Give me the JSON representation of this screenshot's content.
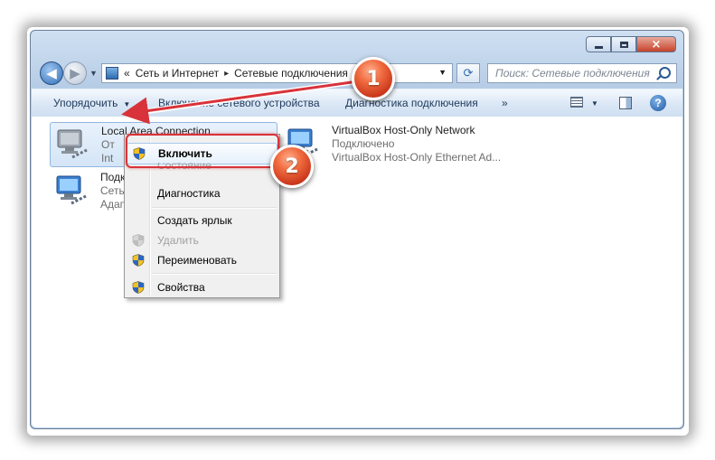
{
  "window": {
    "buttons": {
      "minimize": "minimize",
      "maximize": "maximize",
      "close": "×"
    }
  },
  "nav": {
    "back_glyph": "◀",
    "forward_glyph": "▶",
    "history_glyph": "▼",
    "breadcrumb_root_glyph": "«",
    "breadcrumbs": [
      "Сеть и Интернет",
      "Сетевые подключения"
    ],
    "separator_glyph": "▸",
    "address_drop_glyph": "▼",
    "refresh_glyph": "⟳"
  },
  "search": {
    "placeholder": "Поиск: Сетевые подключения"
  },
  "toolbar": {
    "organize": "Упорядочить",
    "enable_device": "Включение сетевого устройства",
    "diagnose": "Диагностика подключения",
    "more": "»",
    "dropdown_glyph": "▼",
    "help_glyph": "?"
  },
  "connections": [
    {
      "name": "Local Area Connection",
      "status": "От",
      "adapter": "Int"
    },
    {
      "name": "Подк",
      "status": "Сеть",
      "adapter": "Адап"
    },
    {
      "name": "VirtualBox Host-Only Network",
      "status": "Подключено",
      "adapter": "VirtualBox Host-Only Ethernet Ad..."
    }
  ],
  "context_menu": {
    "items": [
      {
        "label": "Включить",
        "shield": true,
        "bold": true,
        "disabled": false
      },
      {
        "label": "Состояние",
        "shield": false,
        "bold": false,
        "disabled": true
      },
      {
        "label": "Диагностика",
        "shield": false,
        "bold": false,
        "disabled": false
      },
      {
        "label": "Создать ярлык",
        "shield": false,
        "bold": false,
        "disabled": false
      },
      {
        "label": "Удалить",
        "shield": true,
        "bold": false,
        "disabled": true
      },
      {
        "label": "Переименовать",
        "shield": true,
        "bold": false,
        "disabled": false
      },
      {
        "label": "Свойства",
        "shield": true,
        "bold": false,
        "disabled": false
      }
    ]
  },
  "annotations": {
    "badge_1": "1",
    "badge_2": "2",
    "color": "#d8333a"
  }
}
